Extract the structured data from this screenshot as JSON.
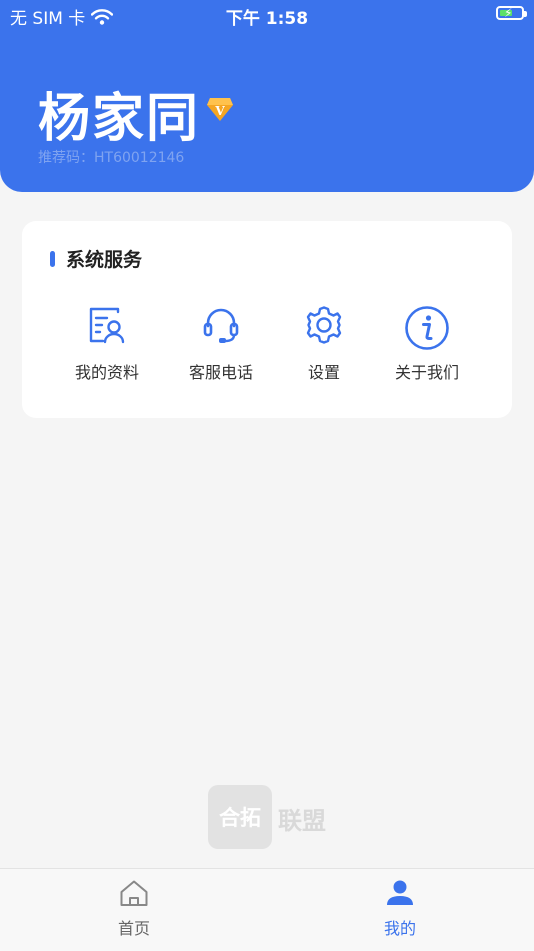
{
  "status_bar": {
    "carrier": "无 SIM 卡",
    "time": "下午 1:58",
    "battery_level": 0.6
  },
  "profile": {
    "name": "杨家同",
    "vip_badge_icon": "vip-diamond-icon",
    "referral": "推荐码：HT60012146"
  },
  "services": {
    "title": "系统服务",
    "items": [
      {
        "label": "我的资料",
        "icon": "profile-card-icon"
      },
      {
        "label": "客服电话",
        "icon": "headset-icon"
      },
      {
        "label": "设置",
        "icon": "gear-icon"
      },
      {
        "label": "关于我们",
        "icon": "info-icon"
      }
    ]
  },
  "watermark": {
    "logo_text": "合拓",
    "brand": "联盟"
  },
  "tabbar": {
    "items": [
      {
        "label": "首页",
        "icon": "home-icon",
        "active": false
      },
      {
        "label": "我的",
        "icon": "user-icon",
        "active": true
      }
    ]
  },
  "colors": {
    "primary": "#3b73ec",
    "background": "#f5f5f5",
    "card": "#ffffff",
    "inactive": "#666666"
  }
}
